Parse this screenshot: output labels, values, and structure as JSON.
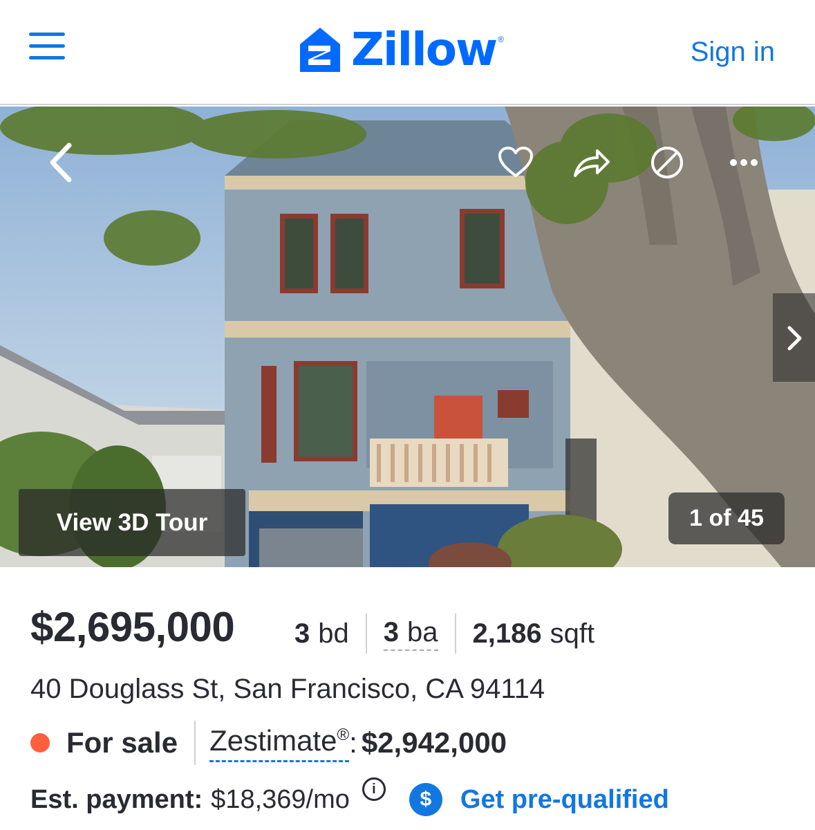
{
  "header": {
    "logo_text": "Zillow",
    "logo_reg": "®",
    "signin_label": "Sign in",
    "icons": [
      "menu-icon",
      "zillow-logo-icon"
    ]
  },
  "gallery": {
    "tour_label": "View 3D Tour",
    "counter": "1 of 45",
    "icons": [
      "back-chevron-icon",
      "heart-icon",
      "share-icon",
      "hide-icon",
      "more-icon",
      "next-chevron-icon"
    ]
  },
  "listing": {
    "price": "$2,695,000",
    "beds_num": "3",
    "beds_unit": "bd",
    "baths_num": "3",
    "baths_unit": "ba",
    "sqft_num": "2,186",
    "sqft_unit": "sqft",
    "address": "40 Douglass St, San Francisco, CA 94114",
    "status": "For sale",
    "zestimate_label": "Zestimate",
    "zestimate_reg": "®",
    "zestimate_colon": ":",
    "zestimate_value": "$2,942,000",
    "est_payment_label": "Est. payment:",
    "est_payment_value": "$18,369/mo",
    "info_glyph": "i",
    "prequal_glyph": "$",
    "prequal_label": "Get pre-qualified"
  },
  "colors": {
    "brand_blue": "#006aff",
    "link_blue": "#1277e1",
    "status_red": "#ff5e3f",
    "text": "#2a2a33"
  }
}
